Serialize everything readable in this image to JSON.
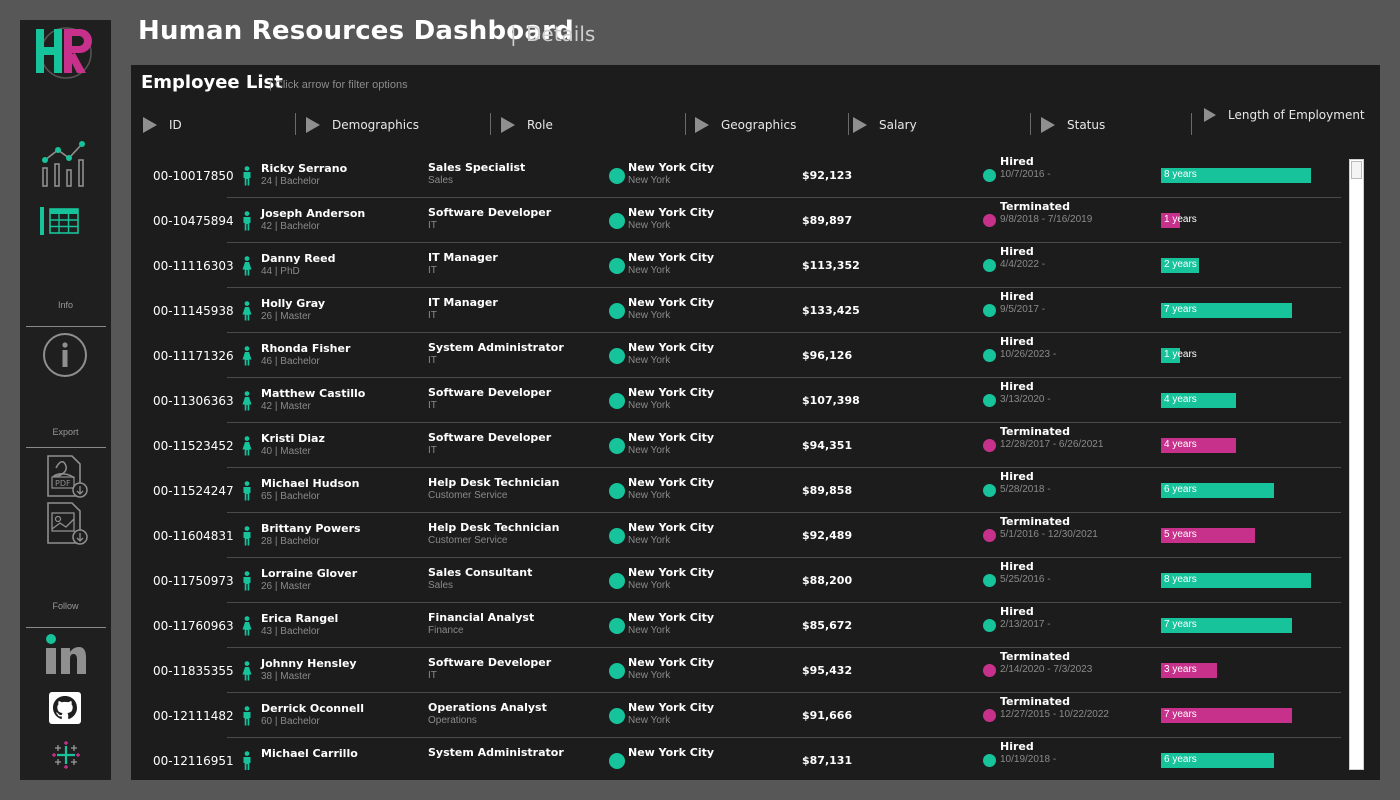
{
  "header": {
    "title": "Human Resources Dashboard",
    "separator": "|",
    "subtitle": "Details"
  },
  "sidebar": {
    "logo": "HR",
    "sections": {
      "info": "Info",
      "export": "Export",
      "follow": "Follow"
    },
    "icons": [
      "line-chart-icon",
      "table-icon",
      "info-icon",
      "pdf-export-icon",
      "image-export-icon",
      "linkedin-icon",
      "github-icon",
      "tableau-icon"
    ]
  },
  "list": {
    "title": "Employee List",
    "hint": "| Click arrow for filter options",
    "columns": [
      "ID",
      "Demographics",
      "Role",
      "Geographics",
      "Salary",
      "Status",
      "Length of Employment"
    ]
  },
  "colors": {
    "hired": "#16c39b",
    "terminated": "#c8318b",
    "panel": "#1c1c1c",
    "background": "#575757"
  },
  "employees": [
    {
      "id": "00-10017850",
      "name": "Ricky Serrano",
      "demo": "24 | Bachelor",
      "gender": "male",
      "role": "Sales Specialist",
      "dept": "Sales",
      "city": "New York City",
      "state": "New York",
      "salary": "$92,123",
      "status": "Hired",
      "dates": "10/7/2016 -",
      "years": 8,
      "years_label": "8 years"
    },
    {
      "id": "00-10475894",
      "name": "Joseph Anderson",
      "demo": "42 | Bachelor",
      "gender": "male",
      "role": "Software Developer",
      "dept": "IT",
      "city": "New York City",
      "state": "New York",
      "salary": "$89,897",
      "status": "Terminated",
      "dates": "9/8/2018 - 7/16/2019",
      "years": 1,
      "years_label": "1 years"
    },
    {
      "id": "00-11116303",
      "name": "Danny Reed",
      "demo": "44 | PhD",
      "gender": "female",
      "role": "IT Manager",
      "dept": "IT",
      "city": "New York City",
      "state": "New York",
      "salary": "$113,352",
      "status": "Hired",
      "dates": "4/4/2022 -",
      "years": 2,
      "years_label": "2 years"
    },
    {
      "id": "00-11145938",
      "name": "Holly Gray",
      "demo": "26 | Master",
      "gender": "female",
      "role": "IT Manager",
      "dept": "IT",
      "city": "New York City",
      "state": "New York",
      "salary": "$133,425",
      "status": "Hired",
      "dates": "9/5/2017 -",
      "years": 7,
      "years_label": "7 years"
    },
    {
      "id": "00-11171326",
      "name": "Rhonda Fisher",
      "demo": "46 | Bachelor",
      "gender": "female",
      "role": "System Administrator",
      "dept": "IT",
      "city": "New York City",
      "state": "New York",
      "salary": "$96,126",
      "status": "Hired",
      "dates": "10/26/2023 -",
      "years": 1,
      "years_label": "1 years"
    },
    {
      "id": "00-11306363",
      "name": "Matthew Castillo",
      "demo": "42 | Master",
      "gender": "female",
      "role": "Software Developer",
      "dept": "IT",
      "city": "New York City",
      "state": "New York",
      "salary": "$107,398",
      "status": "Hired",
      "dates": "3/13/2020 -",
      "years": 4,
      "years_label": "4 years"
    },
    {
      "id": "00-11523452",
      "name": "Kristi Diaz",
      "demo": "40 | Master",
      "gender": "female",
      "role": "Software Developer",
      "dept": "IT",
      "city": "New York City",
      "state": "New York",
      "salary": "$94,351",
      "status": "Terminated",
      "dates": "12/28/2017 - 6/26/2021",
      "years": 4,
      "years_label": "4 years"
    },
    {
      "id": "00-11524247",
      "name": "Michael Hudson",
      "demo": "65 | Bachelor",
      "gender": "male",
      "role": "Help Desk Technician",
      "dept": "Customer Service",
      "city": "New York City",
      "state": "New York",
      "salary": "$89,858",
      "status": "Hired",
      "dates": "5/28/2018 -",
      "years": 6,
      "years_label": "6 years"
    },
    {
      "id": "00-11604831",
      "name": "Brittany Powers",
      "demo": "28 | Bachelor",
      "gender": "male",
      "role": "Help Desk Technician",
      "dept": "Customer Service",
      "city": "New York City",
      "state": "New York",
      "salary": "$92,489",
      "status": "Terminated",
      "dates": "5/1/2016 - 12/30/2021",
      "years": 5,
      "years_label": "5 years"
    },
    {
      "id": "00-11750973",
      "name": "Lorraine Glover",
      "demo": "26 | Master",
      "gender": "male",
      "role": "Sales Consultant",
      "dept": "Sales",
      "city": "New York City",
      "state": "New York",
      "salary": "$88,200",
      "status": "Hired",
      "dates": "5/25/2016 -",
      "years": 8,
      "years_label": "8 years"
    },
    {
      "id": "00-11760963",
      "name": "Erica Rangel",
      "demo": "43 | Bachelor",
      "gender": "female",
      "role": "Financial Analyst",
      "dept": "Finance",
      "city": "New York City",
      "state": "New York",
      "salary": "$85,672",
      "status": "Hired",
      "dates": "2/13/2017 -",
      "years": 7,
      "years_label": "7 years"
    },
    {
      "id": "00-11835355",
      "name": "Johnny Hensley",
      "demo": "38 | Master",
      "gender": "female",
      "role": "Software Developer",
      "dept": "IT",
      "city": "New York City",
      "state": "New York",
      "salary": "$95,432",
      "status": "Terminated",
      "dates": "2/14/2020 - 7/3/2023",
      "years": 3,
      "years_label": "3 years"
    },
    {
      "id": "00-12111482",
      "name": "Derrick Oconnell",
      "demo": "60 | Bachelor",
      "gender": "male",
      "role": "Operations Analyst",
      "dept": "Operations",
      "city": "New York City",
      "state": "New York",
      "salary": "$91,666",
      "status": "Terminated",
      "dates": "12/27/2015 - 10/22/2022",
      "years": 7,
      "years_label": "7 years"
    },
    {
      "id": "00-12116951",
      "name": "Michael Carrillo",
      "demo": "",
      "gender": "male",
      "role": "System Administrator",
      "dept": "",
      "city": "New York City",
      "state": "",
      "salary": "$87,131",
      "status": "Hired",
      "dates": "10/19/2018 -",
      "years": 6,
      "years_label": "6 years"
    }
  ]
}
